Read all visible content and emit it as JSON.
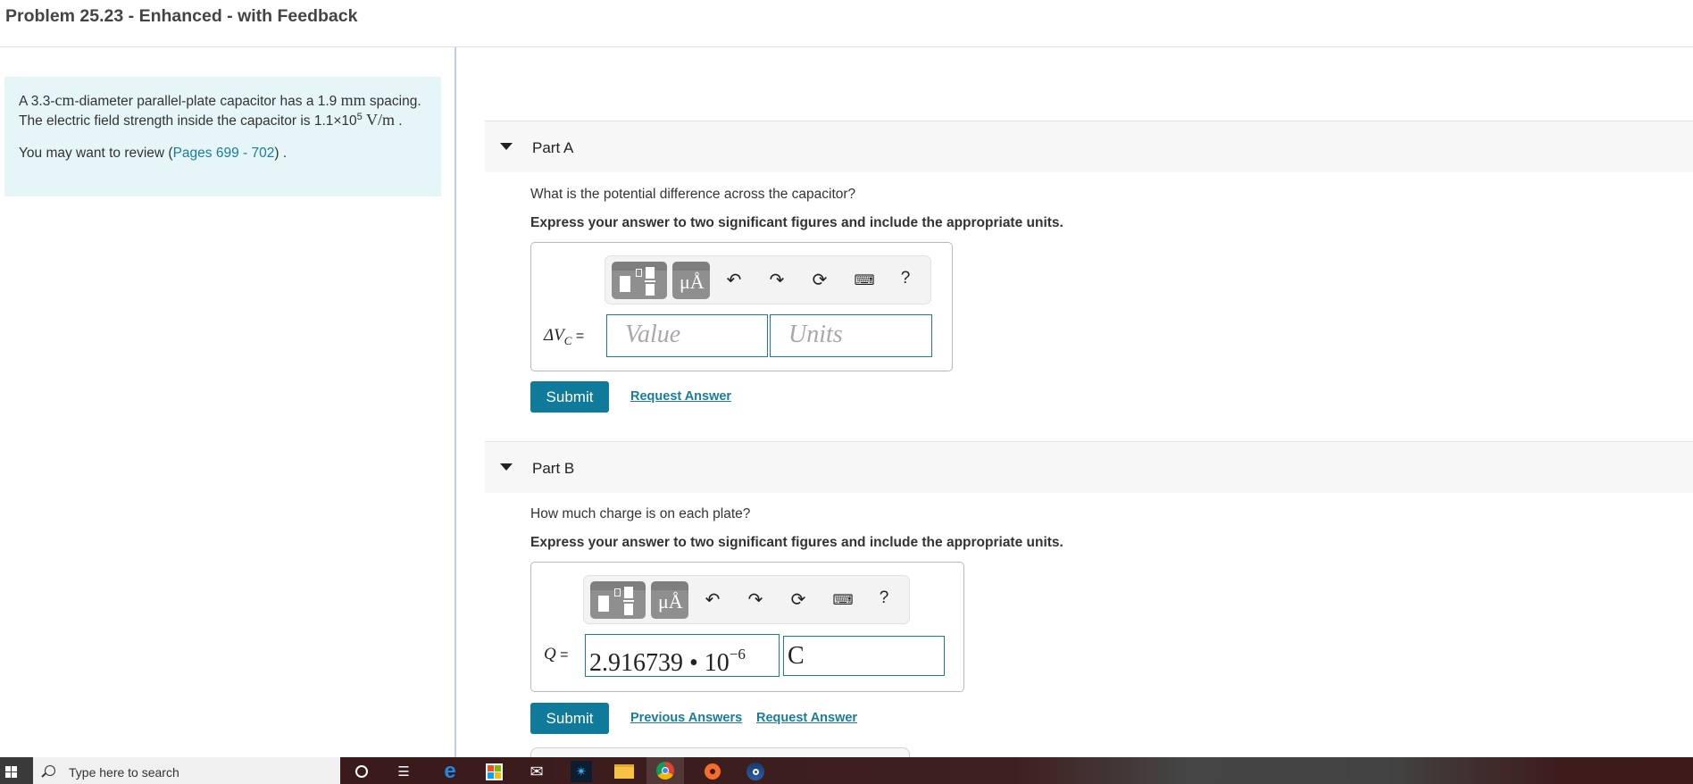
{
  "header": {
    "title": "Problem 25.23 - Enhanced - with Feedback"
  },
  "problem": {
    "text_1": "A 3.3-",
    "unit_cm": "cm",
    "text_2": "-diameter parallel-plate capacitor has a 1.9 ",
    "unit_mm": "mm",
    "text_3": " spacing. The electric field strength inside the capacitor is 1.1×10",
    "exponent": "5",
    "unit_field": " V/m",
    "text_4": " .",
    "review_prefix": "You may want to review (",
    "review_link": "Pages 699 - 702",
    "review_suffix": ") ."
  },
  "toolbar": {
    "templates": "templates-icon",
    "units": "μÅ",
    "undo": "undo-icon",
    "redo": "redo-icon",
    "reset": "reset-icon",
    "keyboard": "keyboard-icon",
    "help": "?"
  },
  "parts": [
    {
      "title": "Part A",
      "question": "What is the potential difference across the capacitor?",
      "instruction": "Express your answer to two significant figures and include the appropriate units.",
      "variable": "ΔV",
      "variable_sub": "C",
      "equals": " =",
      "value_placeholder": "Value",
      "units_placeholder": "Units",
      "submit": "Submit",
      "links": [
        "Request Answer"
      ]
    },
    {
      "title": "Part B",
      "question": "How much charge is on each plate?",
      "instruction": "Express your answer to two significant figures and include the appropriate units.",
      "variable": "Q",
      "equals": " =",
      "value_mantissa": "2.916739 • 10",
      "value_exponent": "−6",
      "units_value": "C",
      "submit": "Submit",
      "links": [
        "Previous Answers",
        "Request Answer"
      ]
    }
  ],
  "taskbar": {
    "search_placeholder": "Type here to search",
    "apps": [
      "cortana",
      "task-view",
      "edge",
      "store",
      "mail",
      "battlenet",
      "file-explorer",
      "chrome",
      "origin",
      "steam"
    ]
  }
}
